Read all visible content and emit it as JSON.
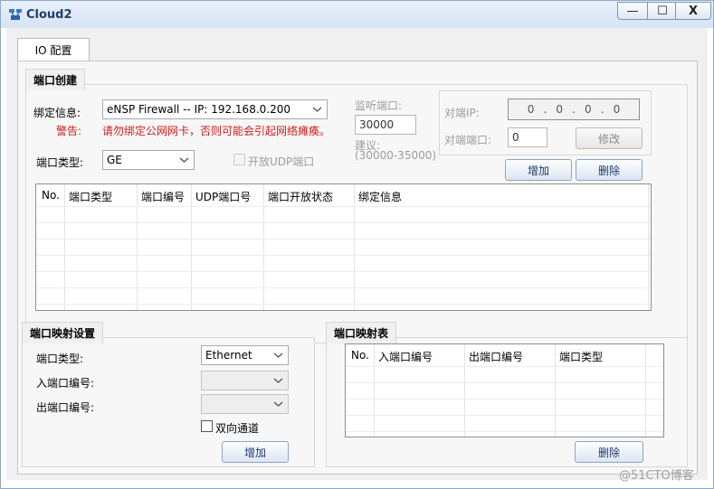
{
  "window": {
    "title": "Cloud2",
    "min_glyph": "—",
    "max_glyph": "☐",
    "close_glyph": "X"
  },
  "tabs": [
    {
      "label": "IO 配置"
    }
  ],
  "port_create": {
    "title": "端口创建",
    "bind_label": "绑定信息:",
    "bind_value": "eNSP Firewall -- IP: 192.168.0.200",
    "warning_label": "警告:",
    "warning_text": "请勿绑定公网网卡，否则可能会引起网络瘫痪。",
    "port_type_label": "端口类型:",
    "port_type_value": "GE",
    "udp_checkbox_label": "开放UDP端口",
    "listen_port_label": "监听端口:",
    "listen_port_value": "30000",
    "suggest_label": "建议:",
    "suggest_range": "(30000-35000)",
    "peer_ip_label": "对端IP:",
    "peer_ip_octets": [
      "0",
      "0",
      "0",
      "0"
    ],
    "peer_port_label": "对端端口:",
    "peer_port_value": "0",
    "modify_button": "修改",
    "add_button": "增加",
    "delete_button": "删除",
    "table": {
      "columns": [
        "No.",
        "端口类型",
        "端口编号",
        "UDP端口号",
        "端口开放状态",
        "绑定信息"
      ],
      "rows": []
    }
  },
  "mapping_settings": {
    "title": "端口映射设置",
    "port_type_label": "端口类型:",
    "port_type_value": "Ethernet",
    "in_port_label": "入端口编号:",
    "in_port_value": "",
    "out_port_label": "出端口编号:",
    "out_port_value": "",
    "bidirectional_label": "双向通道",
    "add_button": "增加"
  },
  "mapping_table": {
    "title": "端口映射表",
    "columns": [
      "No.",
      "入端口编号",
      "出端口编号",
      "端口类型"
    ],
    "rows": [],
    "delete_button": "删除"
  },
  "watermark": "@51CTO博客",
  "colors": {
    "accent": "#1f3d66",
    "warning": "#d11c1c",
    "disabled_text": "#9c9c9c"
  }
}
